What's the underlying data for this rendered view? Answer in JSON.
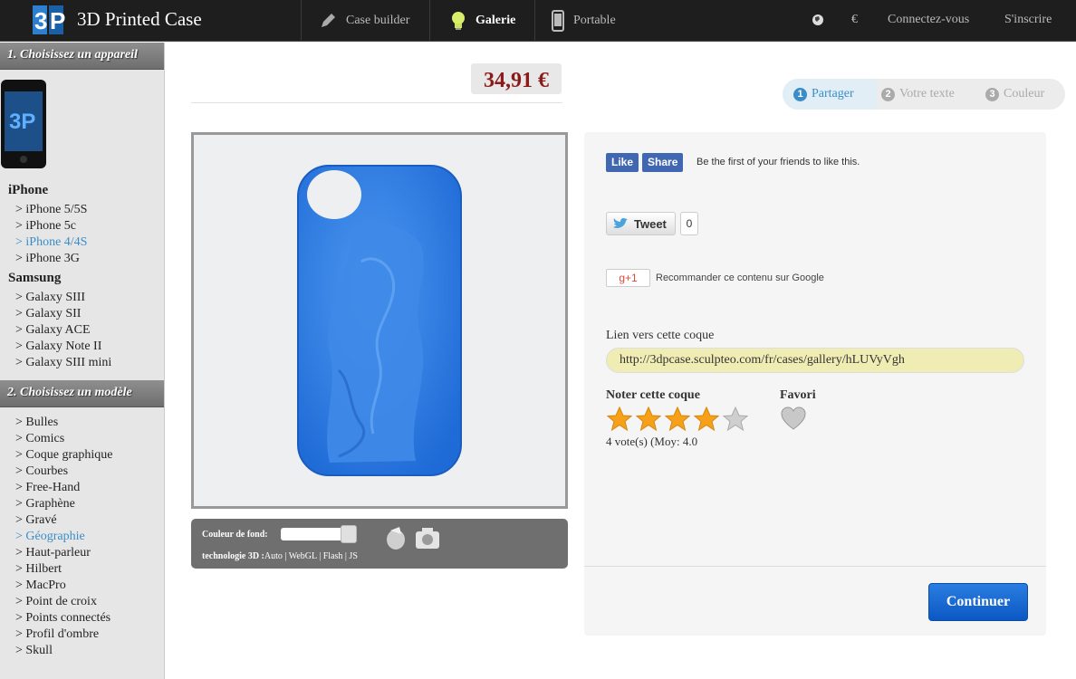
{
  "topbar": {
    "brand": "3D Printed Case",
    "nav": [
      {
        "label": "Case builder",
        "icon": "pencil-icon"
      },
      {
        "label": "Galerie",
        "icon": "lightbulb-icon"
      },
      {
        "label": "Portable",
        "icon": "phone-icon"
      }
    ],
    "right": {
      "currency": "€",
      "login": "Connectez-vous",
      "register": "S'inscrire"
    }
  },
  "sidebar": {
    "section1": "1. Choisissez un appareil",
    "iphone_label": "iPhone",
    "iphone": [
      "> iPhone 5/5S",
      "> iPhone 5c",
      "> iPhone 4/4S",
      "> iPhone 3G"
    ],
    "iphone_selected": 2,
    "samsung_label": "Samsung",
    "samsung": [
      "> Galaxy SIII",
      "> Galaxy SII",
      "> Galaxy ACE",
      "> Galaxy Note II",
      "> Galaxy SIII mini"
    ],
    "section2": "2. Choisissez un modèle",
    "models": [
      "> Bulles",
      "> Comics",
      "> Coque graphique",
      "> Courbes",
      "> Free-Hand",
      "> Graphène",
      "> Gravé",
      "> Géographie",
      "> Haut-parleur",
      "> Hilbert",
      "> MacPro",
      "> Point de croix",
      "> Points connectés",
      "> Profil d'ombre",
      "> Skull"
    ],
    "model_selected": 7
  },
  "price": "34,91 €",
  "steps": [
    {
      "num": "1",
      "label": "Partager"
    },
    {
      "num": "2",
      "label": "Votre texte"
    },
    {
      "num": "3",
      "label": "Couleur"
    }
  ],
  "viewer": {
    "bg_label": "Couleur de fond:",
    "tech_label": "technologie 3D :",
    "tech_options": "Auto | WebGL | Flash | JS",
    "case_color": "#2f7fe4"
  },
  "share": {
    "fb_like": "Like",
    "fb_share": "Share",
    "fb_text": "Be the first of your friends to like this.",
    "tweet": "Tweet",
    "tweet_count": "0",
    "gplus": "g+1",
    "gplus_text": "Recommander ce contenu sur Google",
    "link_label": "Lien vers cette coque",
    "link_value": "http://3dpcase.sculpteo.com/fr/cases/gallery/hLUVyVgh",
    "rate_label": "Noter cette coque",
    "fav_label": "Favori",
    "rating": 4,
    "max_rating": 5,
    "votes": "4 vote(s) (Moy: 4.0",
    "continue": "Continuer"
  }
}
